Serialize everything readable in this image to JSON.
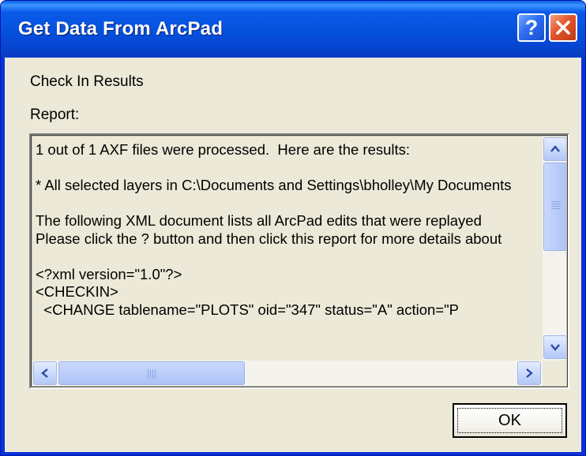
{
  "window": {
    "title": "Get Data From ArcPad"
  },
  "title_buttons": {
    "help_label": "?",
    "close_icon": "close-icon"
  },
  "labels": {
    "heading": "Check In Results",
    "report": "Report:"
  },
  "report": {
    "lines": [
      "1 out of 1 AXF files were processed.  Here are the results:",
      "",
      "* All selected layers in C:\\Documents and Settings\\bholley\\My Documents",
      "",
      "The following XML document lists all ArcPad edits that were replayed",
      "Please click the ? button and then click this report for more details about",
      "",
      "<?xml version=\"1.0\"?>",
      "<CHECKIN>",
      "  <CHANGE tablename=\"PLOTS\" oid=\"347\" status=\"A\" action=\"P"
    ]
  },
  "scrollbars": {
    "vertical": {
      "position": 0.0
    },
    "horizontal": {
      "position": 0.0
    }
  },
  "buttons": {
    "ok_label": "OK"
  },
  "colors": {
    "titlebar": "#0a5ae8",
    "dialog_face": "#ece9d8",
    "close_button": "#e2542c",
    "help_button": "#2e6cf0"
  }
}
